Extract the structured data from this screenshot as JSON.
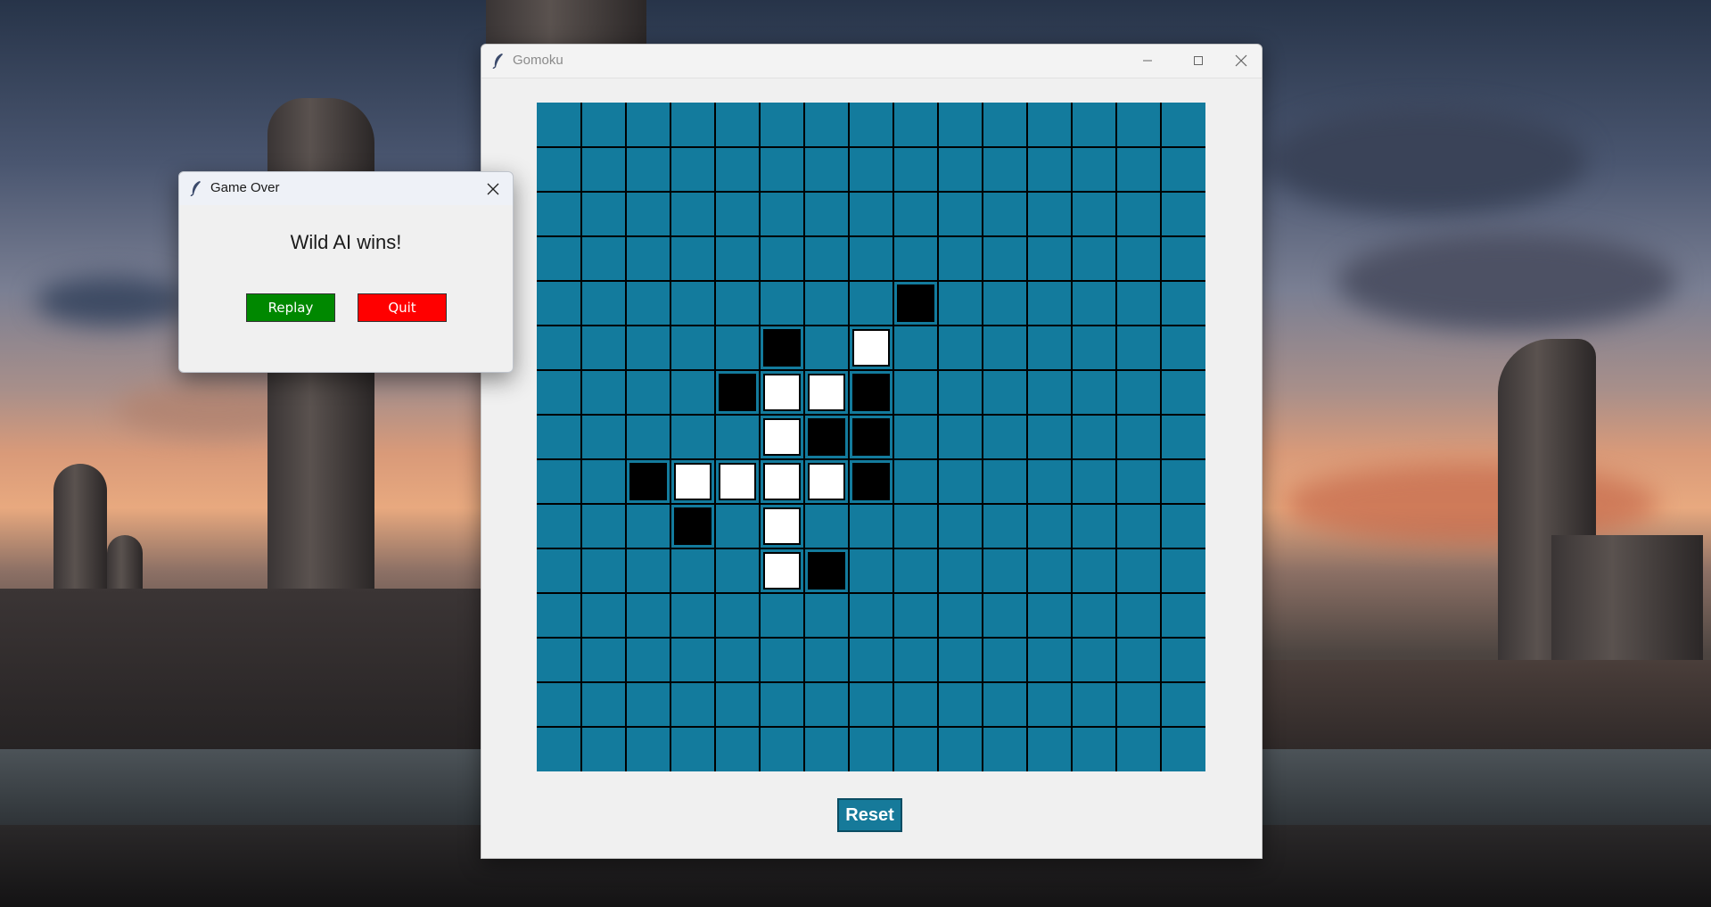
{
  "main_window": {
    "title": "Gomoku",
    "minimize_icon": "minimize-icon",
    "maximize_icon": "maximize-icon",
    "close_icon": "close-icon",
    "app_icon": "feather-icon"
  },
  "board": {
    "size": 15,
    "board_color": "#137b9d",
    "grid_color": "#000000",
    "black_color": "#000000",
    "white_color": "#ffffff",
    "stones": [
      {
        "row": 4,
        "col": 8,
        "color": "black"
      },
      {
        "row": 5,
        "col": 5,
        "color": "black"
      },
      {
        "row": 5,
        "col": 7,
        "color": "white"
      },
      {
        "row": 6,
        "col": 4,
        "color": "black"
      },
      {
        "row": 6,
        "col": 5,
        "color": "white"
      },
      {
        "row": 6,
        "col": 6,
        "color": "white"
      },
      {
        "row": 6,
        "col": 7,
        "color": "black"
      },
      {
        "row": 7,
        "col": 5,
        "color": "white"
      },
      {
        "row": 7,
        "col": 6,
        "color": "black"
      },
      {
        "row": 7,
        "col": 7,
        "color": "black"
      },
      {
        "row": 8,
        "col": 2,
        "color": "black"
      },
      {
        "row": 8,
        "col": 3,
        "color": "white"
      },
      {
        "row": 8,
        "col": 4,
        "color": "white"
      },
      {
        "row": 8,
        "col": 5,
        "color": "white"
      },
      {
        "row": 8,
        "col": 6,
        "color": "white"
      },
      {
        "row": 8,
        "col": 7,
        "color": "black"
      },
      {
        "row": 9,
        "col": 3,
        "color": "black"
      },
      {
        "row": 9,
        "col": 5,
        "color": "white"
      },
      {
        "row": 10,
        "col": 5,
        "color": "white"
      },
      {
        "row": 10,
        "col": 6,
        "color": "black"
      }
    ]
  },
  "reset_label": "Reset",
  "dialog": {
    "title": "Game Over",
    "message": "Wild AI wins!",
    "replay_label": "Replay",
    "quit_label": "Quit",
    "replay_color": "#008800",
    "quit_color": "#ff0000",
    "close_icon": "close-icon",
    "app_icon": "feather-icon"
  }
}
